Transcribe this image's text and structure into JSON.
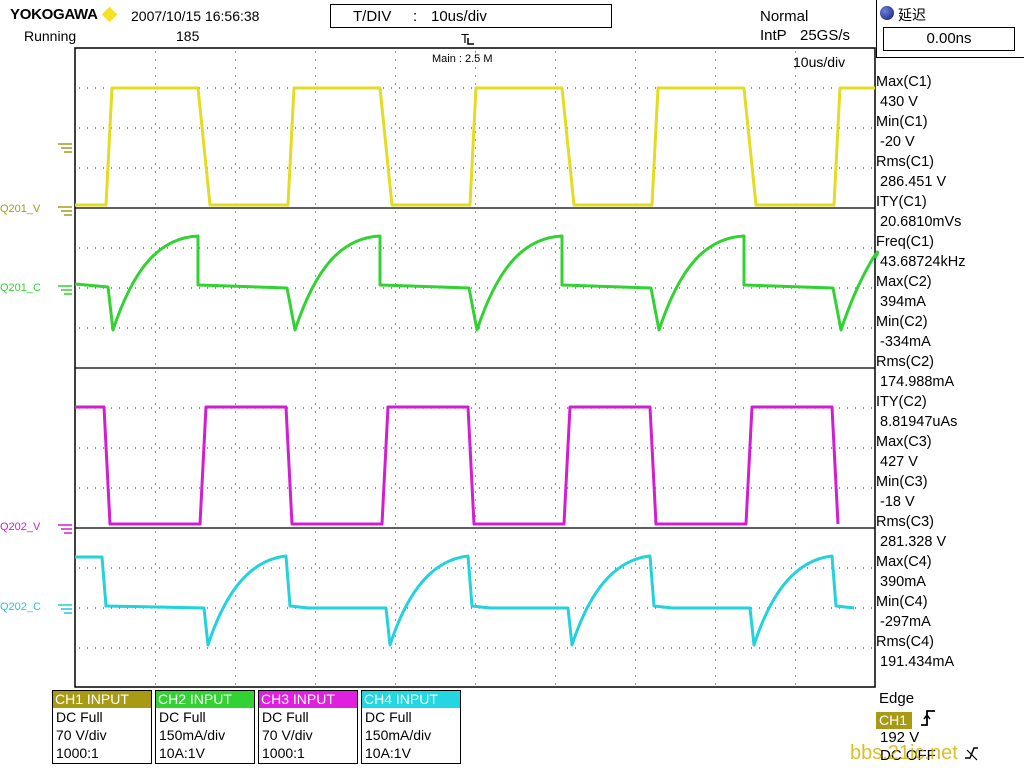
{
  "header": {
    "brand": "YOKOGAWA",
    "datetime": "2007/10/15 16:56:38",
    "run_state": "Running",
    "acq_count": "185",
    "tdiv_label": "T/DIV",
    "tdiv_sep": ":",
    "tdiv_value": "10us/div",
    "trigger_mode": "Normal",
    "sample_mode": "IntP",
    "sample_rate": "25GS/s",
    "main_label": "Main : 2.5 M",
    "grid_tdiv": "10us/div"
  },
  "delay": {
    "label": "延迟",
    "value": "0.00ns"
  },
  "channel_labels": {
    "q201v": "Q201_V",
    "q201c": "Q201_C",
    "q202v": "Q202_V",
    "q202c": "Q202_C",
    "trig_marker": "T"
  },
  "measurements": [
    "Max(C1)",
    "430 V",
    "Min(C1)",
    "-20 V",
    "Rms(C1)",
    "286.451 V",
    "ITY(C1)",
    "20.6810mVs",
    "Freq(C1)",
    "43.68724kHz",
    "Max(C2)",
    "394mA",
    "Min(C2)",
    "-334mA",
    "Rms(C2)",
    "174.988mA",
    "ITY(C2)",
    "8.81947uAs",
    "Max(C3)",
    "427 V",
    "Min(C3)",
    "-18 V",
    "Rms(C3)",
    "281.328 V",
    "Max(C4)",
    "390mA",
    "Min(C4)",
    "-297mA",
    "Rms(C4)",
    "191.434mA"
  ],
  "channels": [
    {
      "header": "CH1 INPUT",
      "coupling": "DC Full",
      "scale": "70 V/div",
      "probe": "1000:1",
      "color": "#a89a14"
    },
    {
      "header": "CH2 INPUT",
      "coupling": "DC Full",
      "scale": "150mA/div",
      "probe": "10A:1V",
      "color": "#33d233"
    },
    {
      "header": "CH3 INPUT",
      "coupling": "DC Full",
      "scale": "70 V/div",
      "probe": "1000:1",
      "color": "#e020e0"
    },
    {
      "header": "CH4 INPUT",
      "coupling": "DC Full",
      "scale": "150mA/div",
      "probe": "10A:1V",
      "color": "#22d6e2"
    }
  ],
  "trigger": {
    "type": "Edge",
    "source": "CH1",
    "level": "192 V",
    "coupling": "DC OFF"
  },
  "watermark": "bbs.21ic.net",
  "colors": {
    "ch1": "#e0d81c",
    "ch2": "#33d233",
    "ch3": "#d21ed2",
    "ch4": "#22d2dc",
    "grid": "#000000"
  }
}
